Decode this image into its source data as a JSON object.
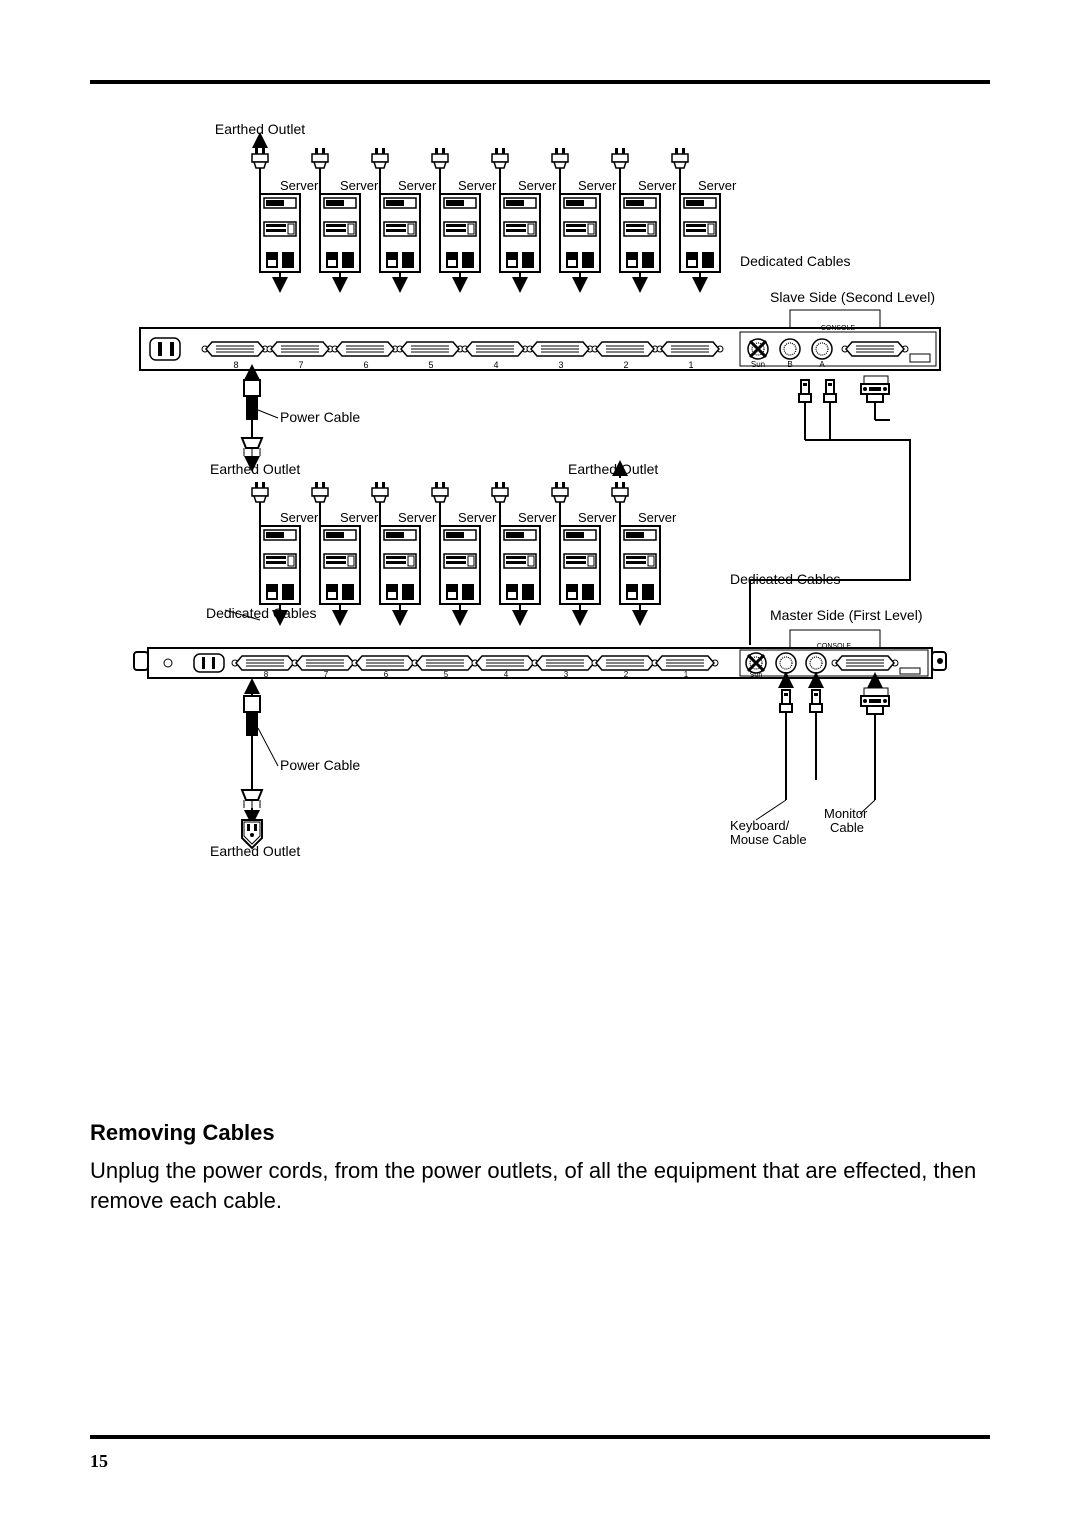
{
  "diagram": {
    "earthed_outlet": "Earthed Outlet",
    "server": "Server",
    "dedicated_cables": "Dedicated Cables",
    "slave_side": "Slave Side (Second Level)",
    "master_side": "Master Side (First Level)",
    "power_cable": "Power Cable",
    "keyboard_mouse_cable": "Keyboard/\nMouse Cable",
    "monitor_cable": "Monitor\nCable",
    "console": "CONSOLE",
    "sun": "Sun",
    "a_label": "A",
    "b_label": "B",
    "port_nums_top": [
      "8",
      "7",
      "6",
      "5",
      "4",
      "3",
      "2",
      "1"
    ],
    "port_nums_bot": [
      "8",
      "7",
      "6",
      "5",
      "4",
      "3",
      "2",
      "1"
    ]
  },
  "section": {
    "heading": "Removing Cables",
    "paragraph": "Unplug the power cords, from the power outlets, of all the equipment that are effected, then remove each cable."
  },
  "page_number": "15"
}
